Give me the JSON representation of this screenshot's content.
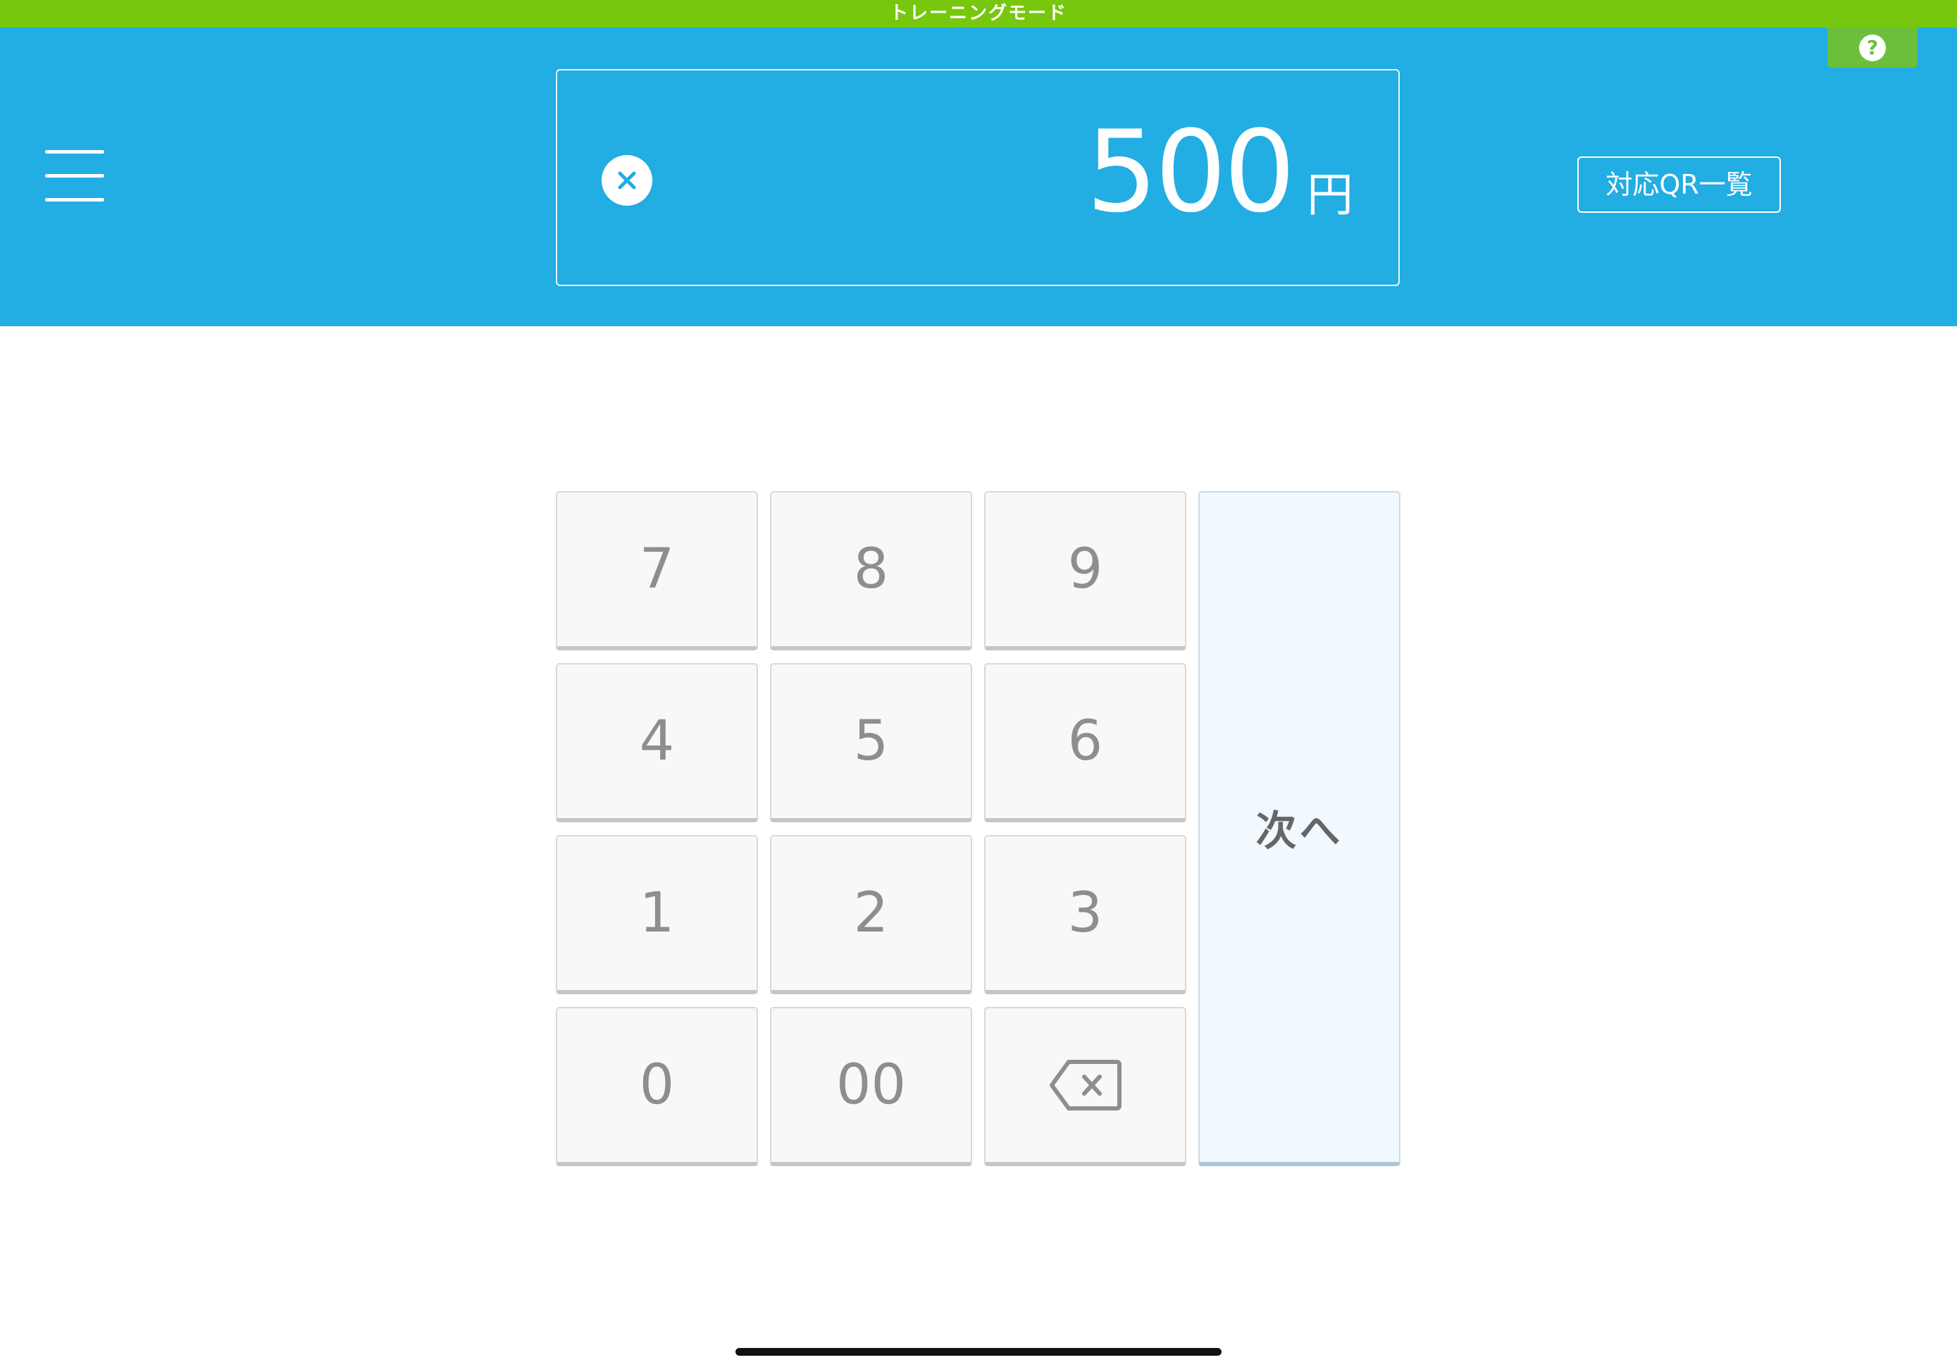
{
  "training_banner": "トレーニングモード",
  "help": {
    "label": "?"
  },
  "amount": {
    "value": "500",
    "unit": "円"
  },
  "qr_list_button": "対応QR一覧",
  "keypad": {
    "k7": "7",
    "k8": "8",
    "k9": "9",
    "k4": "4",
    "k5": "5",
    "k6": "6",
    "k1": "1",
    "k2": "2",
    "k3": "3",
    "k0": "0",
    "k00": "00",
    "next": "次へ"
  },
  "icons": {
    "menu": "hamburger-menu-icon",
    "clear": "clear-circle-icon",
    "help": "question-circle-icon",
    "backspace": "backspace-icon"
  },
  "colors": {
    "header": "#22ade3",
    "training_bar": "#77c70e",
    "help_tab": "#6cbf3a",
    "key_bg": "#f8f8f8",
    "next_bg": "#f1f8fe"
  }
}
